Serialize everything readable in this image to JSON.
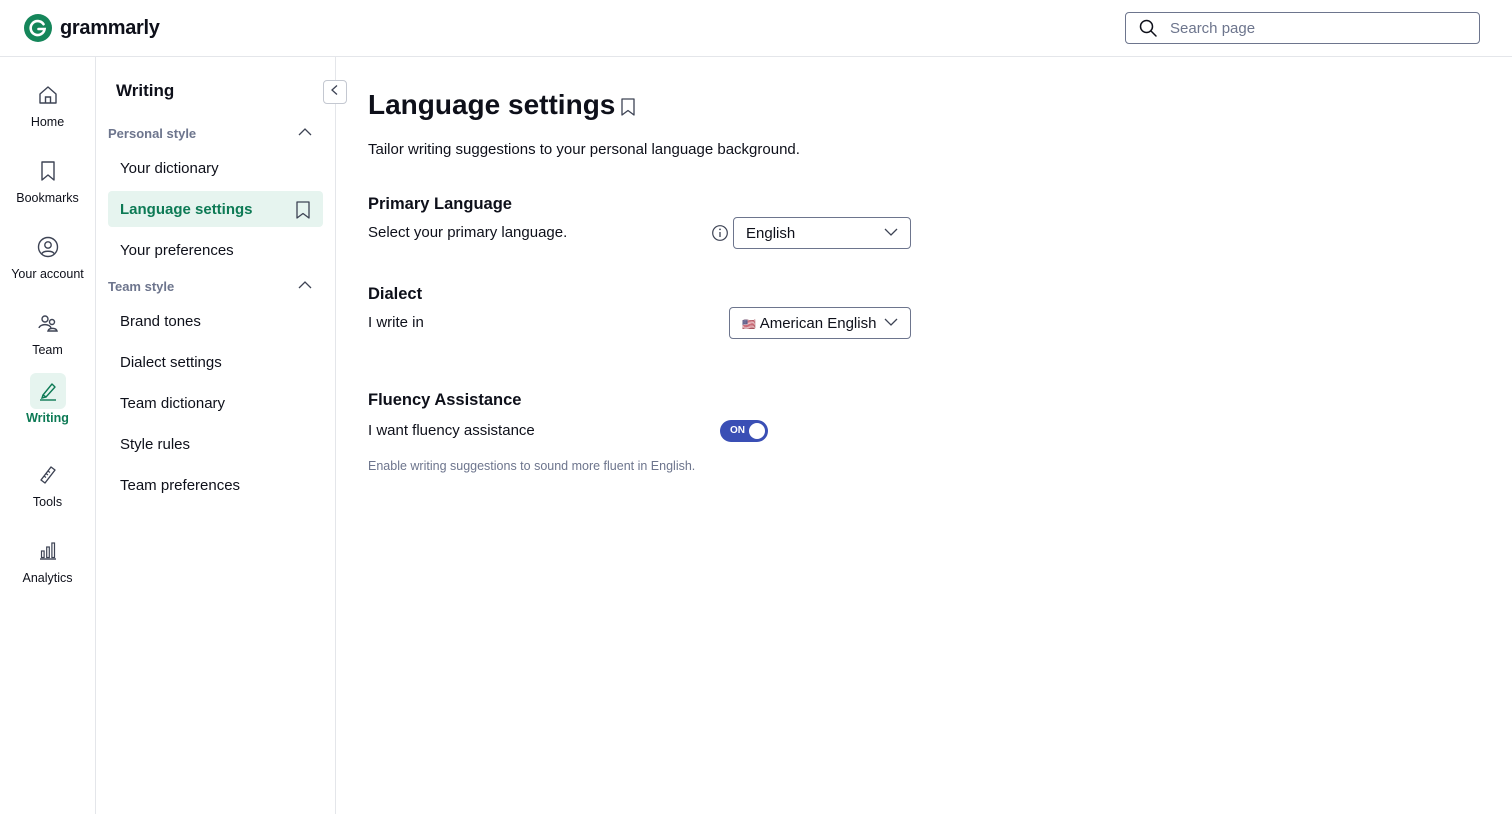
{
  "brand": {
    "name": "grammarly",
    "color": "#15865a"
  },
  "search": {
    "placeholder": "Search page",
    "value": ""
  },
  "rail": {
    "items": [
      {
        "label": "Home",
        "icon": "home-icon"
      },
      {
        "label": "Bookmarks",
        "icon": "bookmark-icon"
      },
      {
        "label": "Your account",
        "icon": "account-icon"
      },
      {
        "label": "Team",
        "icon": "team-icon"
      },
      {
        "label": "Writing",
        "icon": "pen-icon",
        "active": true
      },
      {
        "label": "Tools",
        "icon": "tools-icon"
      },
      {
        "label": "Analytics",
        "icon": "analytics-icon"
      }
    ]
  },
  "subnav": {
    "title": "Writing",
    "groups": [
      {
        "label": "Personal style",
        "expanded": true,
        "items": [
          {
            "label": "Your dictionary"
          },
          {
            "label": "Language settings",
            "active": true
          },
          {
            "label": "Your preferences"
          }
        ]
      },
      {
        "label": "Team style",
        "expanded": true,
        "items": [
          {
            "label": "Brand tones"
          },
          {
            "label": "Dialect settings"
          },
          {
            "label": "Team dictionary"
          },
          {
            "label": "Style rules"
          },
          {
            "label": "Team preferences"
          }
        ]
      }
    ]
  },
  "main": {
    "title": "Language settings",
    "description": "Tailor writing suggestions to your personal language background.",
    "primary_language": {
      "title": "Primary Language",
      "label": "Select your primary language.",
      "value": "English"
    },
    "dialect": {
      "title": "Dialect",
      "label": "I write in",
      "flag": "🇺🇸",
      "value": "American English"
    },
    "fluency": {
      "title": "Fluency Assistance",
      "label": "I want fluency assistance",
      "toggle_text": "ON",
      "enabled": true,
      "hint": "Enable writing suggestions to sound more fluent in English."
    }
  },
  "colors": {
    "accent_green": "#0d7a55",
    "active_bg": "#e6f4ef",
    "toggle_on": "#3a4fb5",
    "muted_text": "#6d758d"
  }
}
